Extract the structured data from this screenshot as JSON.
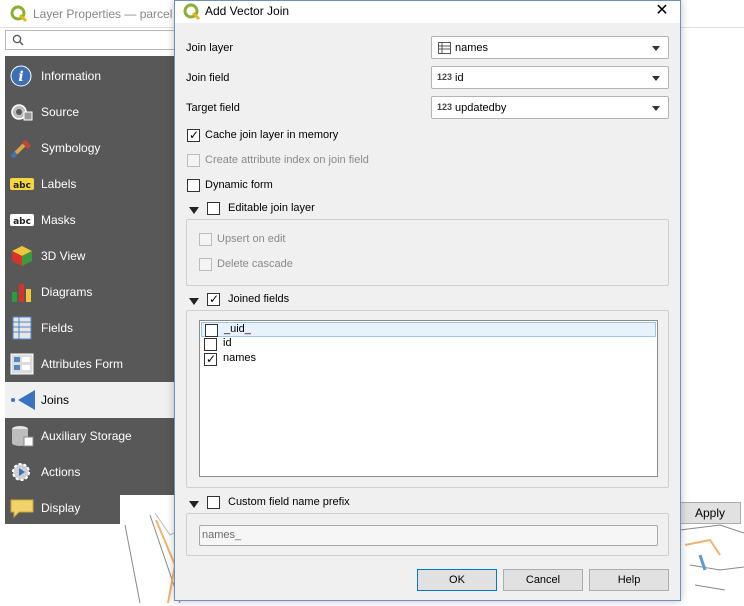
{
  "background_window": {
    "title": "Layer Properties — parcella",
    "search_placeholder": "",
    "apply_label": "Apply"
  },
  "sidebar": {
    "items": [
      {
        "label": "Information",
        "icon": "info-icon"
      },
      {
        "label": "Source",
        "icon": "source-icon"
      },
      {
        "label": "Symbology",
        "icon": "symbology-icon"
      },
      {
        "label": "Labels",
        "icon": "labels-icon"
      },
      {
        "label": "Masks",
        "icon": "masks-icon"
      },
      {
        "label": "3D View",
        "icon": "3d-view-icon"
      },
      {
        "label": "Diagrams",
        "icon": "diagrams-icon"
      },
      {
        "label": "Fields",
        "icon": "fields-icon"
      },
      {
        "label": "Attributes Form",
        "icon": "attributes-form-icon"
      },
      {
        "label": "Joins",
        "icon": "joins-icon",
        "active": true
      },
      {
        "label": "Auxiliary Storage",
        "icon": "auxiliary-storage-icon"
      },
      {
        "label": "Actions",
        "icon": "actions-icon"
      },
      {
        "label": "Display",
        "icon": "display-icon"
      }
    ]
  },
  "dialog": {
    "title": "Add Vector Join",
    "join_layer": {
      "label": "Join layer",
      "value": "names"
    },
    "join_field": {
      "label": "Join field",
      "type_badge": "123",
      "value": "id"
    },
    "target_field": {
      "label": "Target field",
      "type_badge": "123",
      "value": "updatedby"
    },
    "cache": {
      "label": "Cache join layer in memory",
      "checked": true
    },
    "attribute_index": {
      "label": "Create attribute index on join field",
      "checked": false,
      "enabled": false
    },
    "dynamic_form": {
      "label": "Dynamic form",
      "checked": false
    },
    "editable_group": {
      "label": "Editable join layer",
      "checked": false,
      "upsert": {
        "label": "Upsert on edit",
        "checked": false
      },
      "delete_cascade": {
        "label": "Delete cascade",
        "checked": false
      }
    },
    "joined_fields_group": {
      "label": "Joined fields",
      "checked": true,
      "fields": [
        {
          "name": "_uid_",
          "checked": false
        },
        {
          "name": "id",
          "checked": false
        },
        {
          "name": "names",
          "checked": true
        }
      ]
    },
    "prefix_group": {
      "label": "Custom field name prefix",
      "checked": false,
      "placeholder": "names_"
    },
    "buttons": {
      "ok": "OK",
      "cancel": "Cancel",
      "help": "Help"
    }
  }
}
